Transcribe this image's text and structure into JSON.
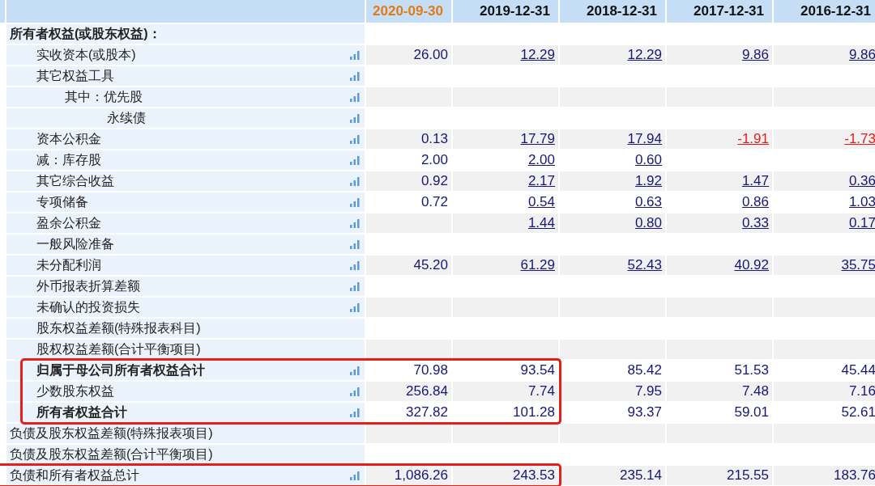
{
  "table": {
    "columns": [
      {
        "label": "2020-09-30",
        "selected": true
      },
      {
        "label": "2019-12-31",
        "selected": false
      },
      {
        "label": "2018-12-31",
        "selected": false
      },
      {
        "label": "2017-12-31",
        "selected": false
      },
      {
        "label": "2016-12-31",
        "selected": false
      }
    ],
    "rows": [
      {
        "label": "所有者权益(或股东权益)：",
        "bold": true,
        "chart_button": false,
        "highlighted": false,
        "cells": [
          null,
          null,
          null,
          null,
          null
        ],
        "children": [
          {
            "label": "实收资本(或股本)",
            "bold": false,
            "chart_button": true,
            "highlighted": false,
            "cells": [
              {
                "text": "26.00",
                "link": false,
                "negative": false
              },
              {
                "text": "12.29",
                "link": true,
                "negative": false
              },
              {
                "text": "12.29",
                "link": true,
                "negative": false
              },
              {
                "text": "9.86",
                "link": true,
                "negative": false
              },
              {
                "text": "9.86",
                "link": true,
                "negative": false
              }
            ]
          },
          {
            "label": "其它权益工具",
            "bold": false,
            "chart_button": true,
            "highlighted": false,
            "cells": [
              null,
              null,
              null,
              null,
              null
            ],
            "children": [
              {
                "label": "其中：优先股",
                "bold": false,
                "chart_button": true,
                "highlighted": false,
                "cells": [
                  null,
                  null,
                  null,
                  null,
                  null
                ],
                "children": [
                  {
                    "label": "永续债",
                    "bold": false,
                    "chart_button": true,
                    "highlighted": false,
                    "cells": [
                      null,
                      null,
                      null,
                      null,
                      null
                    ]
                  }
                ]
              }
            ]
          },
          {
            "label": "资本公积金",
            "bold": false,
            "chart_button": true,
            "highlighted": false,
            "cells": [
              {
                "text": "0.13",
                "link": false,
                "negative": false
              },
              {
                "text": "17.79",
                "link": true,
                "negative": false
              },
              {
                "text": "17.94",
                "link": true,
                "negative": false
              },
              {
                "text": "-1.91",
                "link": true,
                "negative": true
              },
              {
                "text": "-1.73",
                "link": true,
                "negative": true
              }
            ]
          },
          {
            "label": "减：库存股",
            "bold": false,
            "chart_button": true,
            "highlighted": false,
            "cells": [
              {
                "text": "2.00",
                "link": false,
                "negative": false
              },
              {
                "text": "2.00",
                "link": true,
                "negative": false
              },
              {
                "text": "0.60",
                "link": true,
                "negative": false
              },
              null,
              null
            ]
          },
          {
            "label": "其它综合收益",
            "bold": false,
            "chart_button": true,
            "highlighted": false,
            "cells": [
              {
                "text": "0.92",
                "link": false,
                "negative": false
              },
              {
                "text": "2.17",
                "link": true,
                "negative": false
              },
              {
                "text": "1.92",
                "link": true,
                "negative": false
              },
              {
                "text": "1.47",
                "link": true,
                "negative": false
              },
              {
                "text": "0.36",
                "link": true,
                "negative": false
              }
            ]
          },
          {
            "label": "专项储备",
            "bold": false,
            "chart_button": true,
            "highlighted": false,
            "cells": [
              {
                "text": "0.72",
                "link": false,
                "negative": false
              },
              {
                "text": "0.54",
                "link": true,
                "negative": false
              },
              {
                "text": "0.63",
                "link": true,
                "negative": false
              },
              {
                "text": "0.86",
                "link": true,
                "negative": false
              },
              {
                "text": "1.03",
                "link": true,
                "negative": false
              }
            ]
          },
          {
            "label": "盈余公积金",
            "bold": false,
            "chart_button": true,
            "highlighted": false,
            "cells": [
              null,
              {
                "text": "1.44",
                "link": true,
                "negative": false
              },
              {
                "text": "0.80",
                "link": true,
                "negative": false
              },
              {
                "text": "0.33",
                "link": true,
                "negative": false
              },
              {
                "text": "0.17",
                "link": true,
                "negative": false
              }
            ]
          },
          {
            "label": "一般风险准备",
            "bold": false,
            "chart_button": true,
            "highlighted": false,
            "cells": [
              null,
              null,
              null,
              null,
              null
            ]
          },
          {
            "label": "未分配利润",
            "bold": false,
            "chart_button": true,
            "highlighted": false,
            "cells": [
              {
                "text": "45.20",
                "link": false,
                "negative": false
              },
              {
                "text": "61.29",
                "link": true,
                "negative": false
              },
              {
                "text": "52.43",
                "link": true,
                "negative": false
              },
              {
                "text": "40.92",
                "link": true,
                "negative": false
              },
              {
                "text": "35.75",
                "link": true,
                "negative": false
              }
            ]
          },
          {
            "label": "外币报表折算差额",
            "bold": false,
            "chart_button": true,
            "highlighted": false,
            "cells": [
              null,
              null,
              null,
              null,
              null
            ]
          },
          {
            "label": "未确认的投资损失",
            "bold": false,
            "chart_button": true,
            "highlighted": false,
            "cells": [
              null,
              null,
              null,
              null,
              null
            ]
          },
          {
            "label": "股东权益差额(特殊报表科目)",
            "bold": false,
            "chart_button": false,
            "highlighted": false,
            "cells": [
              null,
              null,
              null,
              null,
              null
            ]
          },
          {
            "label": "股权权益差额(合计平衡项目)",
            "bold": false,
            "chart_button": false,
            "highlighted": false,
            "cells": [
              null,
              null,
              null,
              null,
              null
            ]
          },
          {
            "label": "归属于母公司所有者权益合计",
            "bold": true,
            "chart_button": true,
            "highlighted": true,
            "cells": [
              {
                "text": "70.98",
                "link": false,
                "negative": false
              },
              {
                "text": "93.54",
                "link": false,
                "negative": false
              },
              {
                "text": "85.42",
                "link": false,
                "negative": false
              },
              {
                "text": "51.53",
                "link": false,
                "negative": false
              },
              {
                "text": "45.44",
                "link": false,
                "negative": false
              }
            ]
          },
          {
            "label": "少数股东权益",
            "bold": false,
            "chart_button": true,
            "highlighted": true,
            "cells": [
              {
                "text": "256.84",
                "link": false,
                "negative": false
              },
              {
                "text": "7.74",
                "link": false,
                "negative": false
              },
              {
                "text": "7.95",
                "link": false,
                "negative": false
              },
              {
                "text": "7.48",
                "link": false,
                "negative": false
              },
              {
                "text": "7.16",
                "link": false,
                "negative": false
              }
            ]
          },
          {
            "label": "所有者权益合计",
            "bold": true,
            "chart_button": true,
            "highlighted": true,
            "cells": [
              {
                "text": "327.82",
                "link": false,
                "negative": false
              },
              {
                "text": "101.28",
                "link": false,
                "negative": false
              },
              {
                "text": "93.37",
                "link": false,
                "negative": false
              },
              {
                "text": "59.01",
                "link": false,
                "negative": false
              },
              {
                "text": "52.61",
                "link": false,
                "negative": false
              }
            ]
          }
        ]
      },
      {
        "label": "负债及股东权益差额(特殊报表项目)",
        "bold": false,
        "chart_button": false,
        "highlighted": false,
        "cells": [
          null,
          null,
          null,
          null,
          null
        ]
      },
      {
        "label": "负债及股东权益差额(合计平衡项目)",
        "bold": false,
        "chart_button": false,
        "highlighted": false,
        "cells": [
          null,
          null,
          null,
          null,
          null
        ]
      },
      {
        "label": "负债和所有者权益总计",
        "bold": false,
        "chart_button": true,
        "highlighted": true,
        "cells": [
          {
            "text": "1,086.26",
            "link": false,
            "negative": false
          },
          {
            "text": "243.53",
            "link": false,
            "negative": false
          },
          {
            "text": "235.14",
            "link": false,
            "negative": false
          },
          {
            "text": "215.55",
            "link": false,
            "negative": false
          },
          {
            "text": "183.76",
            "link": false,
            "negative": false
          }
        ]
      }
    ]
  }
}
